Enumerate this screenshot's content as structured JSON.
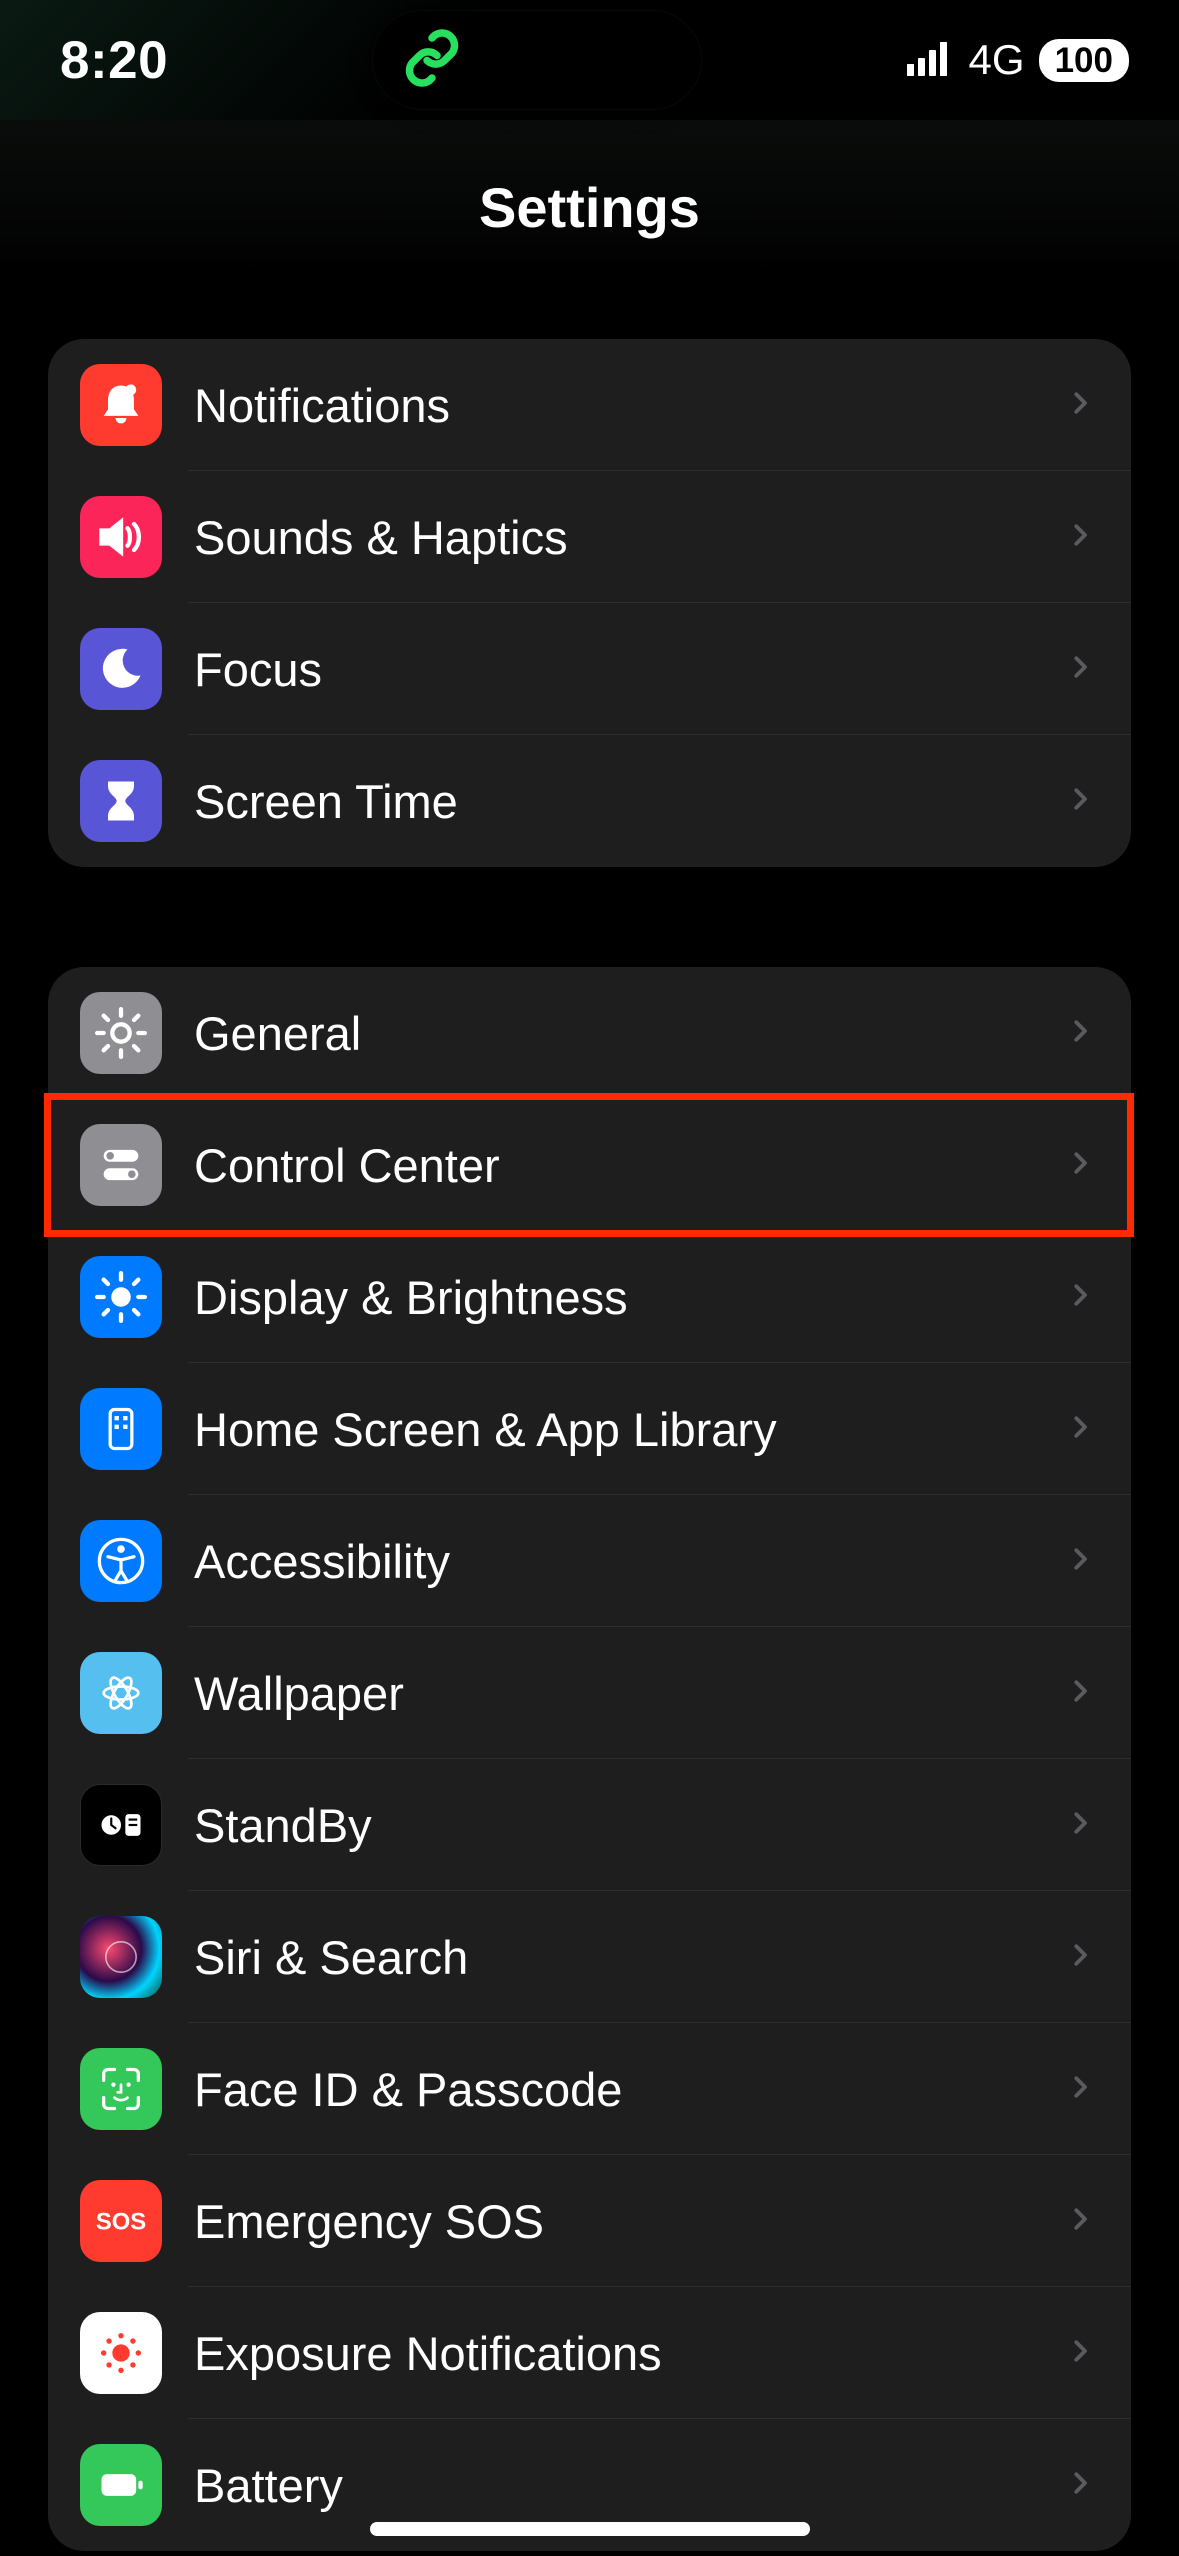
{
  "status": {
    "time": "8:20",
    "network_type": "4G",
    "battery_level": "100"
  },
  "header": {
    "title": "Settings"
  },
  "groups": [
    {
      "items": [
        {
          "id": "notifications",
          "label": "Notifications",
          "icon": "bell-icon",
          "bg": "bg-red"
        },
        {
          "id": "sounds",
          "label": "Sounds & Haptics",
          "icon": "speaker-icon",
          "bg": "bg-pink"
        },
        {
          "id": "focus",
          "label": "Focus",
          "icon": "moon-icon",
          "bg": "bg-indigo"
        },
        {
          "id": "screen-time",
          "label": "Screen Time",
          "icon": "hourglass-icon",
          "bg": "bg-indigo"
        }
      ]
    },
    {
      "items": [
        {
          "id": "general",
          "label": "General",
          "icon": "gear-icon",
          "bg": "bg-grey"
        },
        {
          "id": "control-center",
          "label": "Control Center",
          "icon": "toggles-icon",
          "bg": "bg-grey",
          "highlighted": true
        },
        {
          "id": "display",
          "label": "Display & Brightness",
          "icon": "sun-icon",
          "bg": "bg-blue"
        },
        {
          "id": "home-screen",
          "label": "Home Screen & App Library",
          "icon": "apps-grid-icon",
          "bg": "bg-blue"
        },
        {
          "id": "accessibility",
          "label": "Accessibility",
          "icon": "accessibility-icon",
          "bg": "bg-blue"
        },
        {
          "id": "wallpaper",
          "label": "Wallpaper",
          "icon": "flower-icon",
          "bg": "bg-ltblue"
        },
        {
          "id": "standby",
          "label": "StandBy",
          "icon": "standby-icon",
          "bg": "bg-black"
        },
        {
          "id": "siri",
          "label": "Siri & Search",
          "icon": "siri-icon",
          "bg": "bg-siri"
        },
        {
          "id": "faceid",
          "label": "Face ID & Passcode",
          "icon": "faceid-icon",
          "bg": "bg-green"
        },
        {
          "id": "sos",
          "label": "Emergency SOS",
          "icon": "sos-icon",
          "bg": "bg-red"
        },
        {
          "id": "exposure",
          "label": "Exposure Notifications",
          "icon": "exposure-icon",
          "bg": "bg-white"
        },
        {
          "id": "battery",
          "label": "Battery",
          "icon": "battery-icon",
          "bg": "bg-batt"
        }
      ]
    }
  ]
}
